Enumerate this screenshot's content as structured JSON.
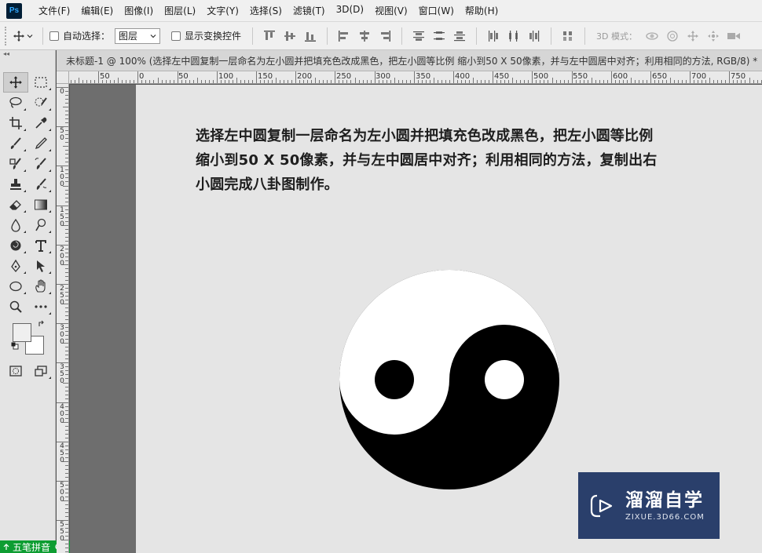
{
  "app": {
    "logo": "Ps"
  },
  "menu": [
    "文件(F)",
    "编辑(E)",
    "图像(I)",
    "图层(L)",
    "文字(Y)",
    "选择(S)",
    "滤镜(T)",
    "3D(D)",
    "视图(V)",
    "窗口(W)",
    "帮助(H)"
  ],
  "options": {
    "auto_select_label": "自动选择：",
    "auto_select_checked": false,
    "layer_select_value": "图层",
    "show_transform_label": "显示变换控件",
    "show_transform_checked": false,
    "mode_3d_label": "3D 模式："
  },
  "document": {
    "tab_title": "未标题-1 @ 100% (选择左中圆复制一层命名为左小圆并把填充色改成黑色，把左小圆等比例 缩小到50 X 50像素，并与左中圆居中对齐；利用相同的方法, RGB/8) *",
    "instruction_lines": [
      "选择左中圆复制一层命名为左小圆并把填充色改成黑色，把左小圆等比例",
      "缩小到50 X 50像素，并与左中圆居中对齐；利用相同的方法，复制出右",
      "小圆完成八卦图制作。"
    ]
  },
  "rulers": {
    "horizontal_labels": [
      "50",
      "0",
      "50",
      "100",
      "150",
      "200",
      "250",
      "300",
      "350",
      "400",
      "450",
      "500",
      "550",
      "600",
      "650",
      "700",
      "750"
    ],
    "vertical_labels": [
      "0",
      "5\n0",
      "1\n0\n0",
      "1\n5\n0",
      "2\n0\n0",
      "2\n5\n0",
      "3\n0\n0",
      "3\n5\n0",
      "4\n0\n0",
      "4\n5\n0",
      "5\n0\n0",
      "5\n5\n0"
    ]
  },
  "colors": {
    "foreground": "#efefef",
    "background": "#ffffff",
    "canvas": "#e5e5e5",
    "watermark_bg": "#2a3f6b",
    "ime_bg": "#0e9d32"
  },
  "watermark": {
    "name": "溜溜自学",
    "url": "ZIXUE.3D66.COM"
  },
  "ime": {
    "label": "五笔拼音"
  }
}
